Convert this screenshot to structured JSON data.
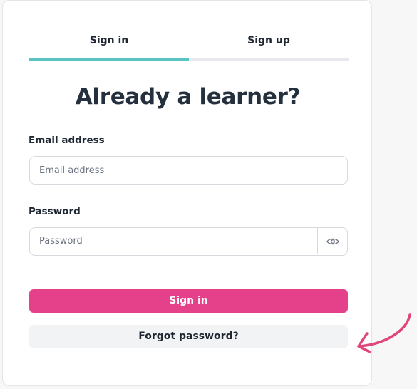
{
  "tabs": {
    "signin_label": "Sign in",
    "signup_label": "Sign up",
    "active": "Sign in"
  },
  "heading": "Already a learner?",
  "email": {
    "label": "Email address",
    "placeholder": "Email address",
    "value": ""
  },
  "password": {
    "label": "Password",
    "placeholder": "Password",
    "value": "",
    "toggle_icon": "eye-icon"
  },
  "buttons": {
    "signin_label": "Sign in",
    "forgot_label": "Forgot password?"
  },
  "annotation": {
    "arrow_icon": "curved-arrow-icon",
    "color": "#e0457b"
  },
  "colors": {
    "accent_teal": "#58c4c6",
    "primary_pink": "#e5408a",
    "heading": "#25303e"
  }
}
